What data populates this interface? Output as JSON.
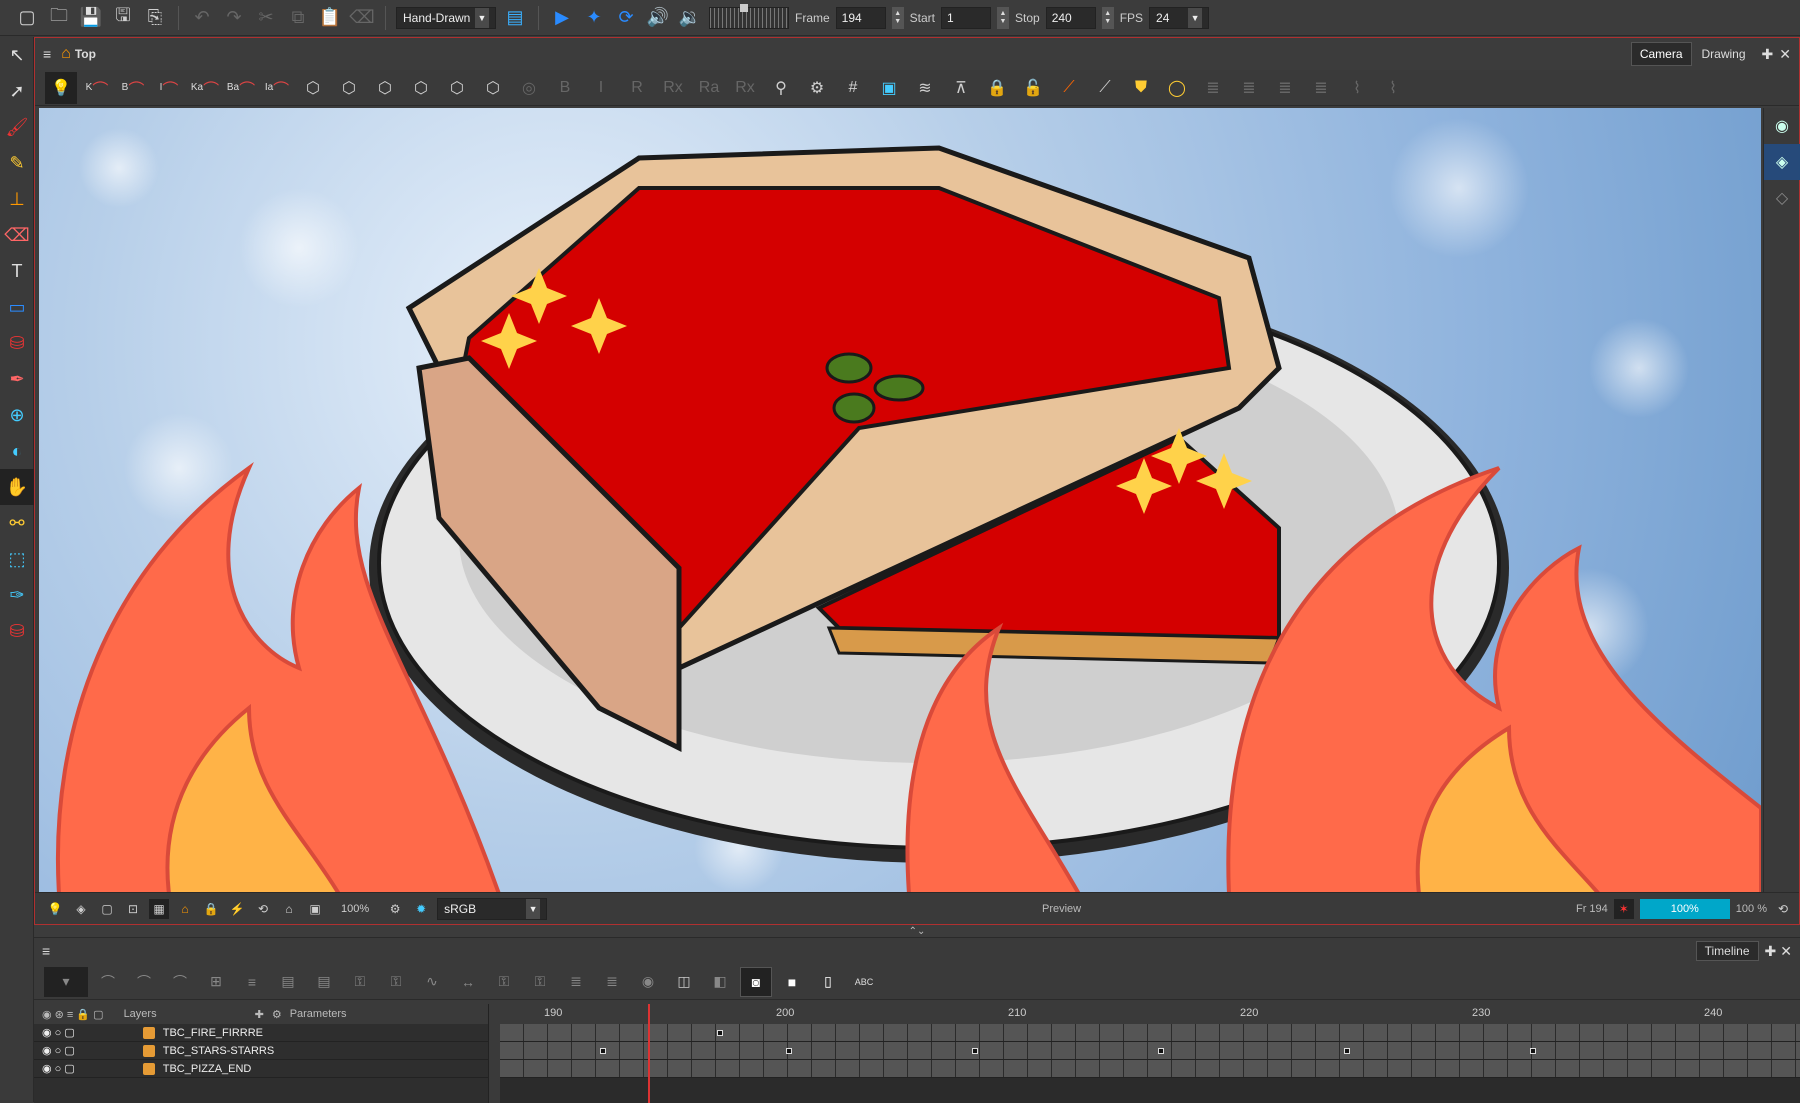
{
  "topbar": {
    "render_mode": "Hand-Drawn",
    "frame_label": "Frame",
    "frame_value": "194",
    "start_label": "Start",
    "start_value": "1",
    "stop_label": "Stop",
    "stop_value": "240",
    "fps_label": "FPS",
    "fps_value": "24"
  },
  "view": {
    "title": "Top",
    "tabs": [
      {
        "label": "Camera"
      },
      {
        "label": "Drawing"
      }
    ],
    "tool_letters": [
      "K",
      "B",
      "I",
      "Ka",
      "Ba",
      "Ia",
      "R",
      "Rx",
      "Ra",
      "Rx"
    ],
    "bottom": {
      "zoom_label": "100%",
      "color_space": "sRGB",
      "preview": "Preview",
      "frame_readout": "Fr 194",
      "zoom_box": "100%",
      "zoom_right": "100 %"
    }
  },
  "timeline": {
    "title": "Timeline",
    "layers_header": "Layers",
    "params_header": "Parameters",
    "layers": [
      {
        "name": "TBC_FIRE_FIRRRE"
      },
      {
        "name": "TBC_STARS-STARRS"
      },
      {
        "name": "TBC_PIZZA_END"
      }
    ],
    "ruler": [
      "190",
      "200",
      "210",
      "220",
      "230",
      "240"
    ]
  },
  "colors": {
    "accent": "#00a7c9",
    "panel_border": "#b03030",
    "sauce": "#d40000",
    "crust": "#e8c39a",
    "fire": "#ff6a4a"
  }
}
